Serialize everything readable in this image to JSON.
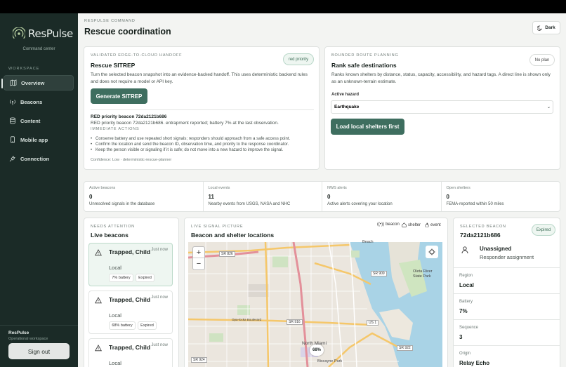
{
  "app": {
    "name": "ResPulse",
    "subtitle": "Command center"
  },
  "sidebar": {
    "section_label": "WORKSPACE",
    "items": [
      {
        "label": "Overview",
        "icon": "map-icon",
        "active": true
      },
      {
        "label": "Beacons",
        "icon": "broadcast-icon",
        "active": false
      },
      {
        "label": "Content",
        "icon": "database-icon",
        "active": false
      },
      {
        "label": "Mobile app",
        "icon": "phone-icon",
        "active": false
      },
      {
        "label": "Connection",
        "icon": "plug-icon",
        "active": false
      }
    ],
    "user_name": "ResPulse",
    "user_sub": "Operational workspace",
    "signout_label": "Sign out"
  },
  "header": {
    "eyebrow": "RESPULSE COMMAND",
    "title": "Rescue coordination",
    "dark_label": "Dark"
  },
  "sitrep": {
    "eyebrow": "VALIDATED EDGE-TO-CLOUD HANDOFF",
    "pill": "red priority",
    "title": "Rescue SITREP",
    "description": "Turn the selected beacon snapshot into an evidence-backed handoff. This uses deterministic backend rules and does not require a model or API key.",
    "button": "Generate SITREP",
    "result_title": "RED priority beacon 72da2121b686",
    "result_line": "RED priority beacon 72da2121b686. entrapment reported; battery 7% at the last observation.",
    "actions_label": "IMMEDIATE ACTIONS",
    "actions": [
      "Conserve battery and use repeated short signals; responders should approach from a safe access point.",
      "Confirm the location and send the beacon ID, observation time, and priority to the response coordinator.",
      "Keep the person visible or signaling if it is safe; do not move into a new hazard to improve the signal."
    ],
    "confidence": "Confidence: Low · deterministic-rescue-planner"
  },
  "route": {
    "eyebrow": "BOUNDED ROUTE PLANNING",
    "pill": "No plan",
    "title": "Rank safe destinations",
    "description": "Ranks known shelters by distance, status, capacity, accessibility, and hazard tags. A direct line is shown only as an unknown-terrain estimate.",
    "hazard_label": "Active hazard",
    "hazard_value": "Earthquake",
    "button": "Load local shelters first"
  },
  "stats": [
    {
      "label": "Active beacons",
      "value": "0",
      "sub": "Unresolved signals in the database"
    },
    {
      "label": "Local events",
      "value": "11",
      "sub": "Nearby events from USGS, NASA and NHC"
    },
    {
      "label": "NWS alerts",
      "value": "0",
      "sub": "Active alerts covering your location"
    },
    {
      "label": "Open shelters",
      "value": "0",
      "sub": "FEMA-reported within 50 miles"
    }
  ],
  "beacons_panel": {
    "eyebrow": "NEEDS ATTENTION",
    "title": "Live beacons",
    "items": [
      {
        "title": "Trapped, Child",
        "time": "Just now",
        "region": "Local",
        "battery": "7% battery",
        "status": "Expired"
      },
      {
        "title": "Trapped, Child",
        "time": "Just now",
        "region": "Local",
        "battery": "68% battery",
        "status": "Expired"
      },
      {
        "title": "Trapped, Child",
        "time": "Just now",
        "region": "Local"
      }
    ]
  },
  "map_panel": {
    "eyebrow": "LIVE SIGNAL PICTURE",
    "title": "Beacon and shelter locations",
    "legend": [
      "beacon",
      "shelter",
      "event"
    ],
    "zoom_in": "+",
    "zoom_out": "−",
    "marker_label": "68%",
    "labels": {
      "beach": "Beach",
      "oleta": "Oleta River State Park",
      "north_miami": "North Miami",
      "biscayne": "Biscayne Park",
      "sr826": "SR 826",
      "sr909": "SR 909",
      "sr916": "SR 916",
      "us1": "US 1",
      "sr922": "SR 922",
      "sr924": "SR 924",
      "opa": "Opa-locka Boulevard"
    }
  },
  "selected": {
    "eyebrow": "SELECTED BEACON",
    "id": "72da2121b686",
    "status": "Expired",
    "assignee": "Unassigned",
    "assignee_sub": "Responder assignment",
    "fields": [
      {
        "k": "Region",
        "v": "Local"
      },
      {
        "k": "Battery",
        "v": "7%"
      },
      {
        "k": "Sequence",
        "v": "3"
      },
      {
        "k": "Origin",
        "v": "Relay Echo"
      }
    ]
  },
  "colors": {
    "sidebar": "#1b2b27",
    "accent": "#3e6e5f",
    "background": "#f3f4f2"
  }
}
